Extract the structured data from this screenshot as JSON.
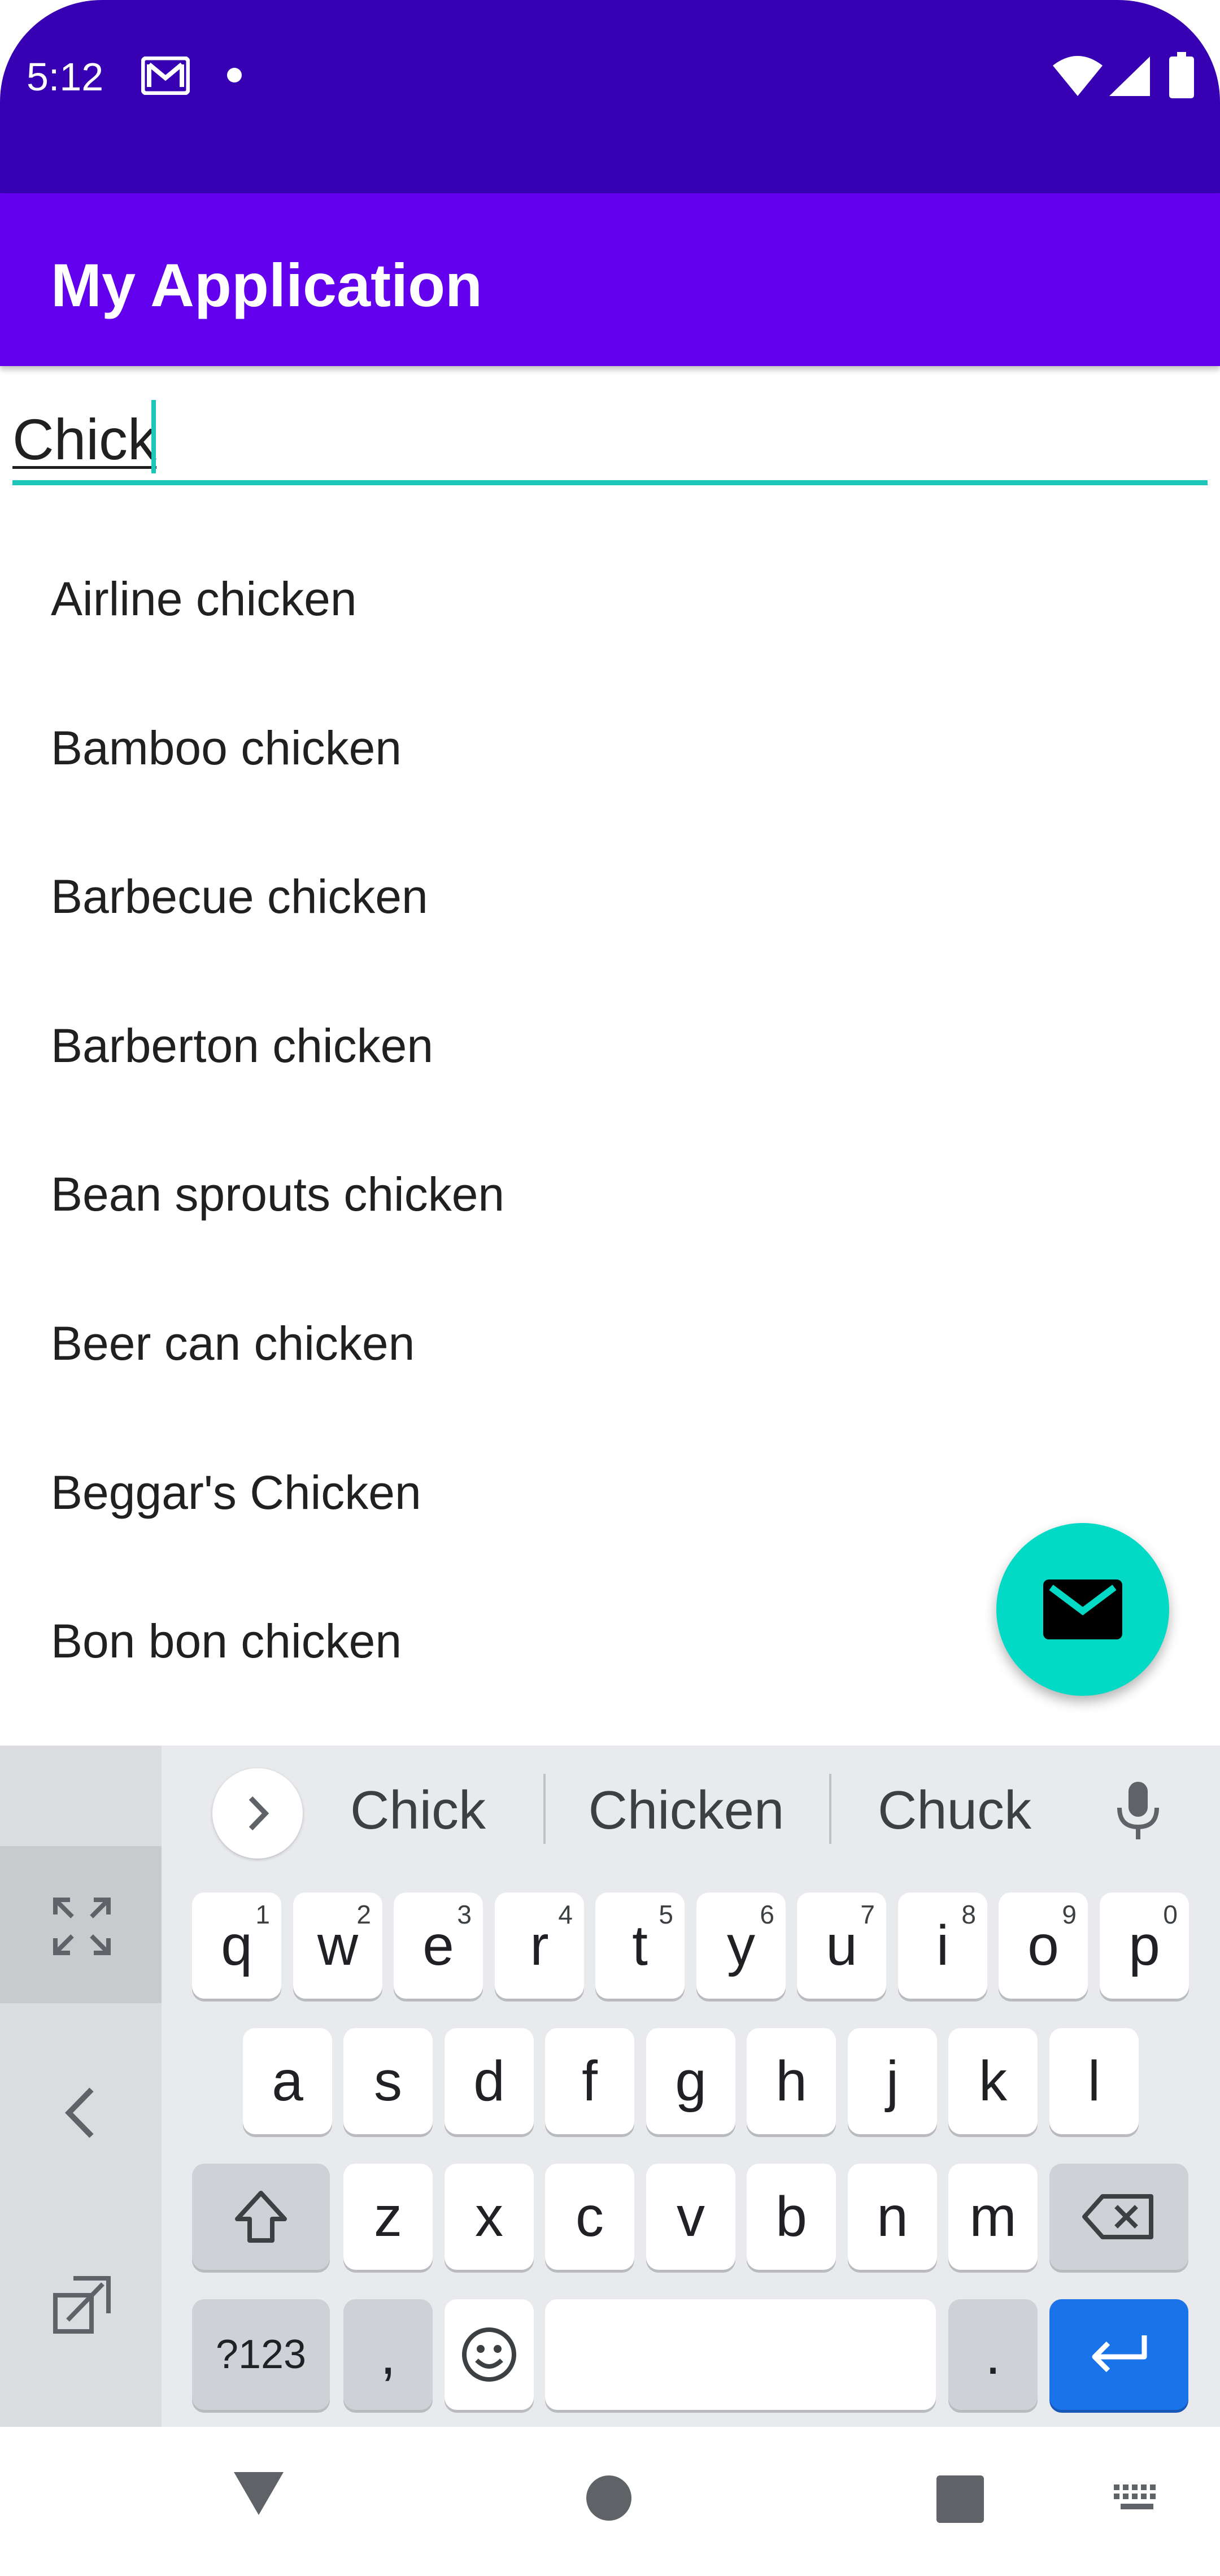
{
  "status_bar": {
    "time": "5:12",
    "icons": [
      "mail-icon",
      "notification-dot-icon",
      "wifi-icon",
      "signal-icon",
      "battery-icon"
    ]
  },
  "app_bar": {
    "title": "My Application"
  },
  "search": {
    "value": "Chick"
  },
  "results": [
    "Airline chicken",
    "Bamboo chicken",
    "Barbecue chicken",
    "Barberton chicken",
    "Bean sprouts chicken",
    "Beer can chicken",
    "Beggar's Chicken",
    "Bon bon chicken"
  ],
  "fab": {
    "icon": "email-icon"
  },
  "keyboard": {
    "suggestions": [
      "Chick",
      "Chicken",
      "Chuck"
    ],
    "row1": [
      {
        "k": "q",
        "n": "1"
      },
      {
        "k": "w",
        "n": "2"
      },
      {
        "k": "e",
        "n": "3"
      },
      {
        "k": "r",
        "n": "4"
      },
      {
        "k": "t",
        "n": "5"
      },
      {
        "k": "y",
        "n": "6"
      },
      {
        "k": "u",
        "n": "7"
      },
      {
        "k": "i",
        "n": "8"
      },
      {
        "k": "o",
        "n": "9"
      },
      {
        "k": "p",
        "n": "0"
      }
    ],
    "row2": [
      "a",
      "s",
      "d",
      "f",
      "g",
      "h",
      "j",
      "k",
      "l"
    ],
    "row3": [
      "z",
      "x",
      "c",
      "v",
      "b",
      "n",
      "m"
    ],
    "symbols_label": "?123",
    "comma_label": ",",
    "period_label": ".",
    "accent_color": "#1a73e8"
  },
  "colors": {
    "status_bar": "#3700b3",
    "app_bar": "#6200ee",
    "accent": "#03dac5"
  }
}
